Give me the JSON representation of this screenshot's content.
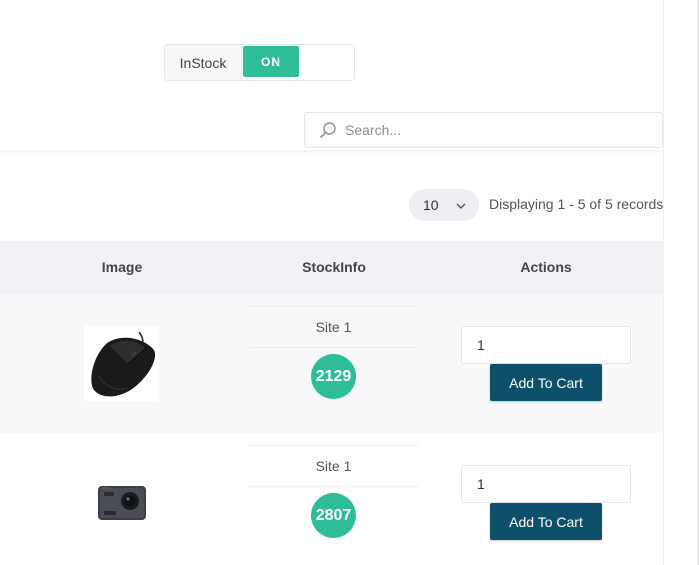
{
  "filter": {
    "instock_label": "InStock",
    "toggle_state": "ON"
  },
  "search": {
    "placeholder": "Search..."
  },
  "pagination": {
    "page_size": "10",
    "records_text": "Displaying 1 - 5 of 5 records"
  },
  "table": {
    "headers": [
      "Image",
      "StockInfo",
      "Actions"
    ],
    "rows": [
      {
        "image": "computer-mouse",
        "site": "Site 1",
        "stock": "2129",
        "qty": "1",
        "button": "Add To Cart"
      },
      {
        "image": "action-camera",
        "site": "Site 1",
        "stock": "2807",
        "qty": "1",
        "button": "Add To Cart"
      }
    ]
  },
  "colors": {
    "accent_green": "#2fbd97",
    "button_blue": "#0e4f6c",
    "header_bg": "#f1f2f6"
  }
}
